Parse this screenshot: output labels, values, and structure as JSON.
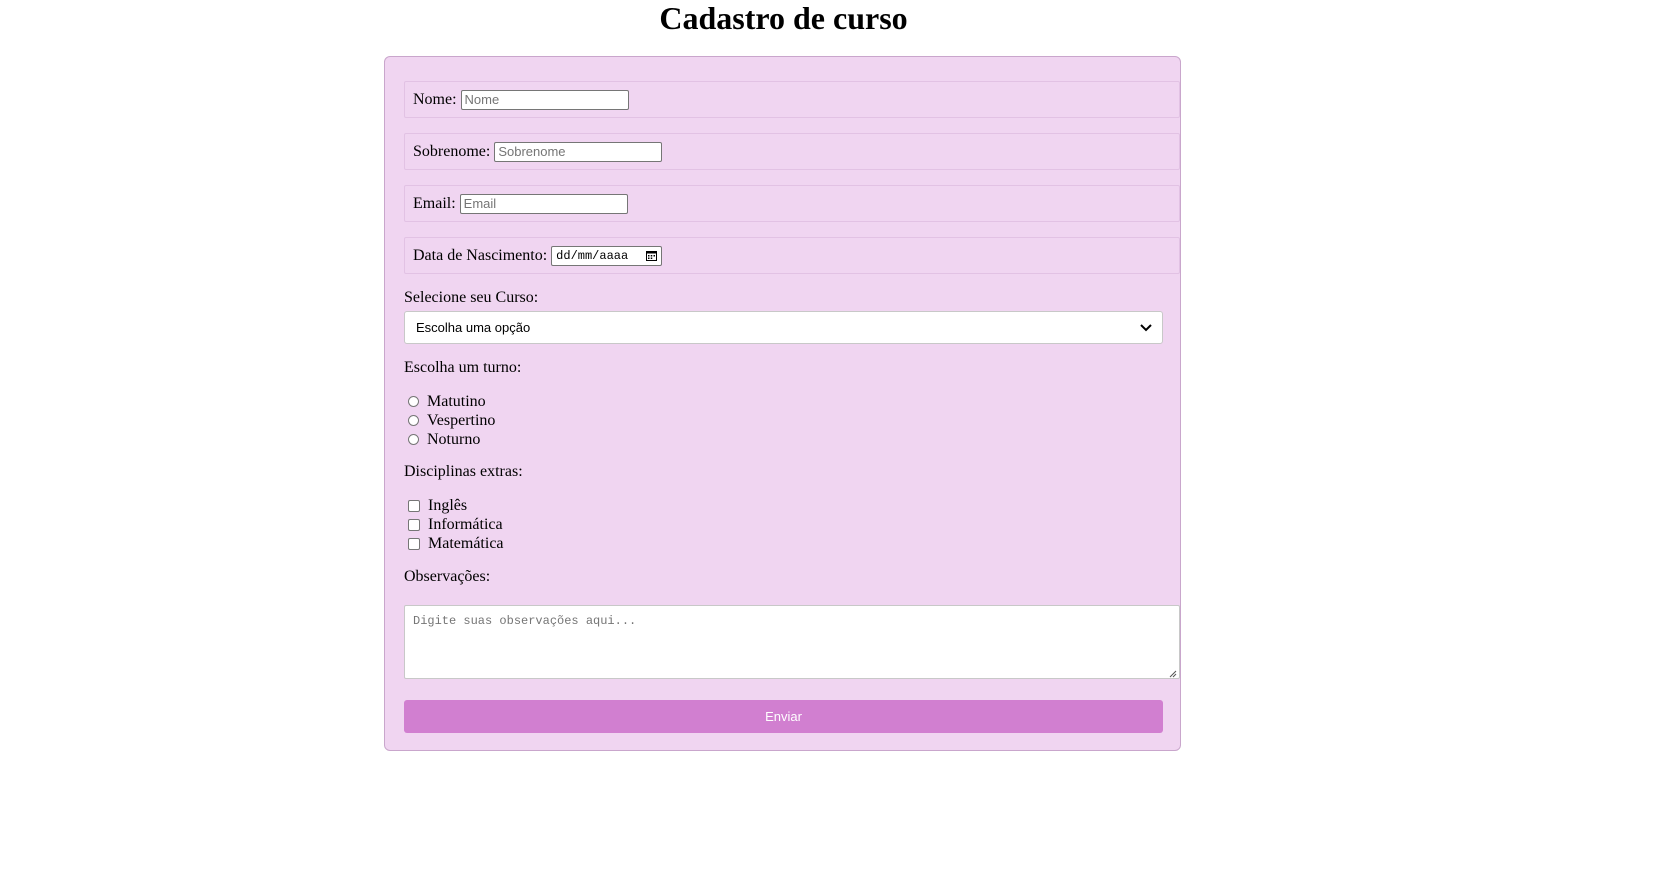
{
  "page": {
    "title": "Cadastro de curso"
  },
  "form": {
    "nome": {
      "label": "Nome:",
      "placeholder": "Nome",
      "value": ""
    },
    "sobrenome": {
      "label": "Sobrenome:",
      "placeholder": "Sobrenome",
      "value": ""
    },
    "email": {
      "label": "Email:",
      "placeholder": "Email",
      "value": ""
    },
    "nascimento": {
      "label": "Data de Nascimento:",
      "placeholder": "dd/mm/aaaa"
    },
    "curso": {
      "label": "Selecione seu Curso:",
      "selected": "Escolha uma opção"
    },
    "turno": {
      "label": "Escolha um turno:",
      "options": [
        "Matutino",
        "Vespertino",
        "Noturno"
      ]
    },
    "disciplinas": {
      "label": "Disciplinas extras:",
      "options": [
        "Inglês",
        "Informática",
        "Matemática"
      ]
    },
    "observacoes": {
      "label": "Observações:",
      "placeholder": "Digite suas observações aqui..."
    },
    "submit_label": "Enviar"
  },
  "colors": {
    "panel_bg": "#f0d5f1",
    "button_bg": "#d17fd0"
  }
}
